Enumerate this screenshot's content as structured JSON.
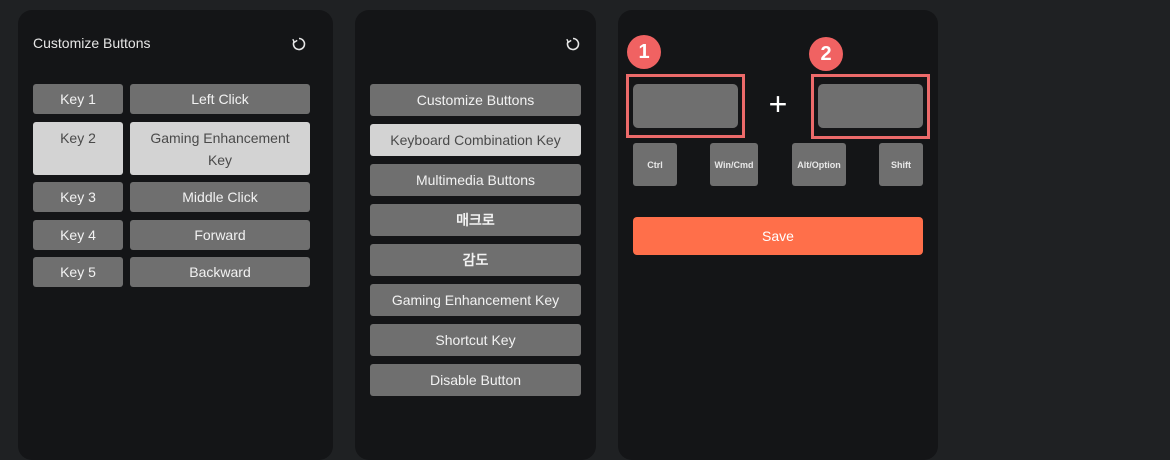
{
  "panel1": {
    "title": "Customize Buttons",
    "refresh_icon": "refresh-icon",
    "rows": [
      {
        "key": "Key 1",
        "action": "Left Click"
      },
      {
        "key": "Key 2",
        "action": "Gaming Enhancement Key"
      },
      {
        "key": "Key 3",
        "action": "Middle Click"
      },
      {
        "key": "Key 4",
        "action": "Forward"
      },
      {
        "key": "Key 5",
        "action": "Backward"
      }
    ],
    "selected": "Key 2"
  },
  "panel2": {
    "refresh_icon": "refresh-icon",
    "menu": [
      "Customize Buttons",
      "Keyboard Combination Key",
      "Multimedia Buttons",
      "매크로",
      "감도",
      "Gaming Enhancement Key",
      "Shortcut Key",
      "Disable Button"
    ],
    "selected": "Keyboard Combination Key"
  },
  "panel3": {
    "badge1": "1",
    "badge2": "2",
    "plus": "+",
    "modifiers": [
      "Ctrl",
      "Win/Cmd",
      "Alt/Option",
      "Shift"
    ],
    "save_label": "Save"
  },
  "colors": {
    "background": "#1f2123",
    "panel": "#141517",
    "button": "#6f6f6f",
    "button_active": "#d3d3d3",
    "save": "#ff6f4a",
    "highlight": "#ec6a6a"
  }
}
